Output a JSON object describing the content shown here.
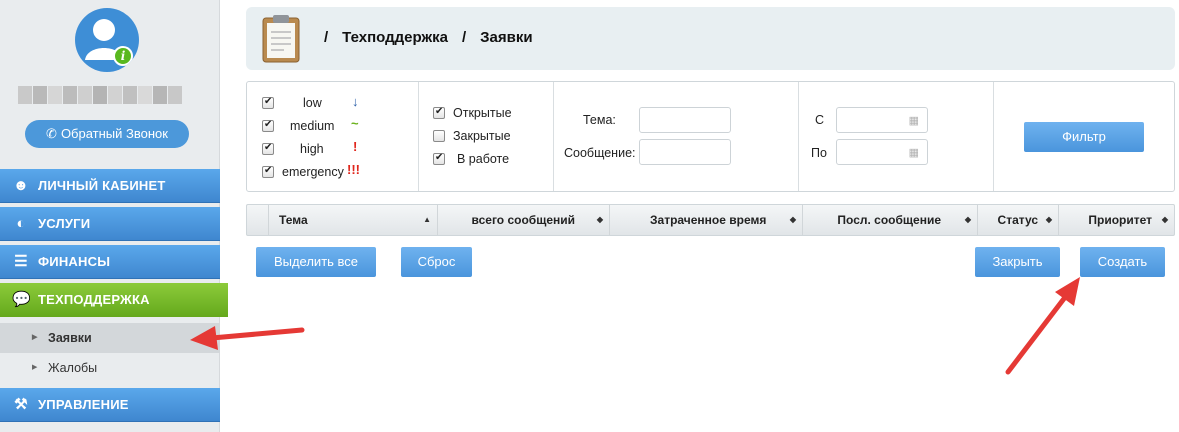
{
  "sidebar": {
    "callback_label": "Обратный Звонок",
    "nav": [
      {
        "label": "ЛИЧНЫЙ КАБИНЕТ",
        "icon": "user-icon"
      },
      {
        "label": "УСЛУГИ",
        "icon": "gauge-icon"
      },
      {
        "label": "ФИНАНСЫ",
        "icon": "coins-icon"
      },
      {
        "label": "ТЕХПОДДЕРЖКА",
        "icon": "speech-bubble-icon"
      },
      {
        "label": "УПРАВЛЕНИЕ",
        "icon": "tools-icon"
      }
    ],
    "sub_items": [
      {
        "label": "Заявки"
      },
      {
        "label": "Жалобы"
      }
    ]
  },
  "header": {
    "crumbs": [
      "/",
      "Техподдержка",
      "/",
      "Заявки"
    ]
  },
  "filter": {
    "priorities": [
      {
        "label": "low",
        "symbol": "↓",
        "checked": true
      },
      {
        "label": "medium",
        "symbol": "~",
        "checked": true
      },
      {
        "label": "high",
        "symbol": "!",
        "checked": true
      },
      {
        "label": "emergency",
        "symbol": "!!!",
        "checked": true
      }
    ],
    "statuses": [
      {
        "label": "Открытые",
        "checked": true
      },
      {
        "label": "Закрытые",
        "checked": false
      },
      {
        "label": "В работе",
        "checked": true
      }
    ],
    "theme_label": "Тема:",
    "theme_value": "",
    "message_label": "Сообщение:",
    "message_value": "",
    "from_label": "С",
    "from_value": "",
    "to_label": "По",
    "to_value": "",
    "filter_button": "Фильтр"
  },
  "table": {
    "columns": [
      "Тема",
      "всего сообщений",
      "Затраченное время",
      "Посл. сообщение",
      "Статус",
      "Приоритет"
    ]
  },
  "actions": {
    "select_all": "Выделить все",
    "reset": "Сброс",
    "close": "Закрыть",
    "create": "Создать"
  },
  "colors": {
    "nav_blue": "#4a96de",
    "nav_green": "#78bb2b",
    "button_blue": "#5aa3e6",
    "annotation_red": "#e53935"
  }
}
